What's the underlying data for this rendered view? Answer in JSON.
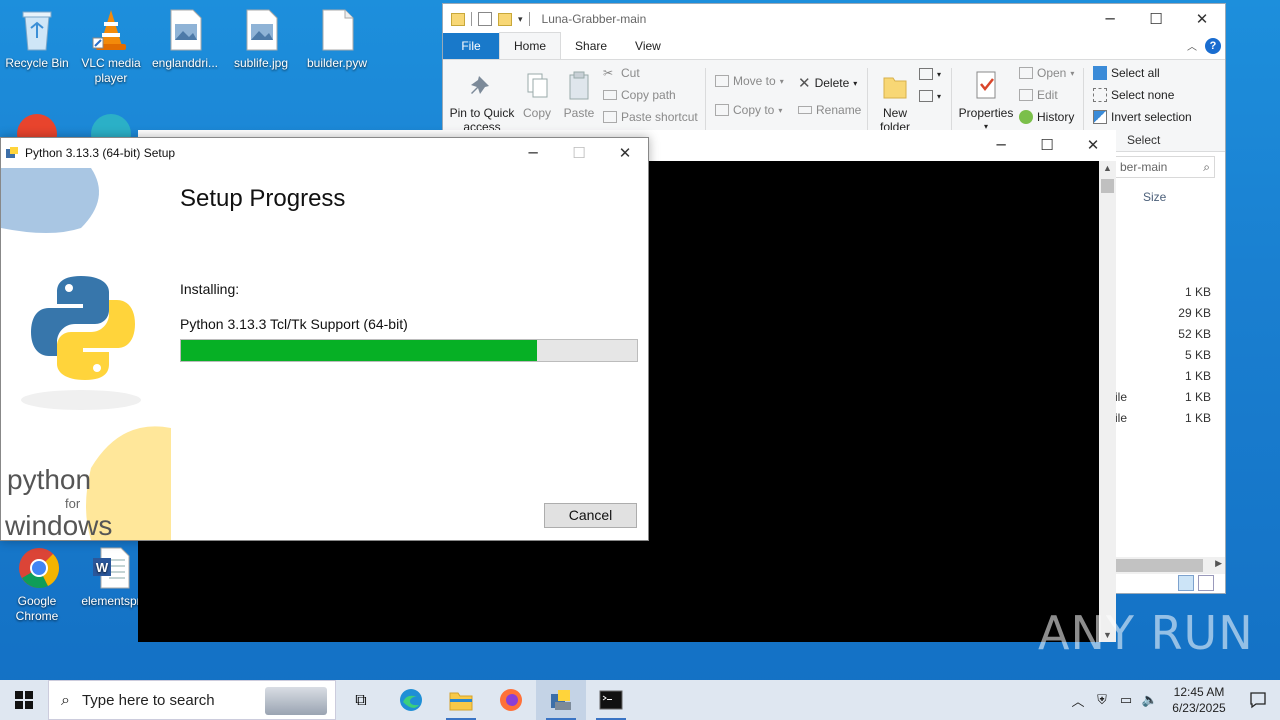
{
  "desktop": {
    "icons": [
      {
        "label": "Recycle Bin"
      },
      {
        "label": "VLC media player"
      },
      {
        "label": "englanddri..."
      },
      {
        "label": "sublife.jpg"
      },
      {
        "label": "builder.pyw"
      },
      {
        "label": "Google Chrome"
      },
      {
        "label": "elementspr"
      }
    ]
  },
  "explorer": {
    "title": "Luna-Grabber-main",
    "tabs": [
      "File",
      "Home",
      "Share",
      "View"
    ],
    "help": "?",
    "ribbon": {
      "pin": "Pin to Quick access",
      "copy": "Copy",
      "paste": "Paste",
      "cut": "Cut",
      "copy_path": "Copy path",
      "paste_shortcut": "Paste shortcut",
      "move_to": "Move to",
      "copy_to": "Copy to",
      "delete": "Delete",
      "rename": "Rename",
      "new_folder": "New folder",
      "properties": "Properties",
      "open": "Open",
      "edit": "Edit",
      "history": "History",
      "select_all": "Select all",
      "select_none": "Select none",
      "invert_selection": "Invert selection",
      "select_group": "Select"
    },
    "search_text": "ber-main",
    "size_header": "Size",
    "rows": [
      {
        "type": "",
        "size": "1 KB"
      },
      {
        "type": "",
        "size": "29 KB"
      },
      {
        "type": "",
        "size": "52 KB"
      },
      {
        "type": "",
        "size": "5 KB"
      },
      {
        "type": "",
        "size": "1 KB"
      },
      {
        "type": "ile",
        "size": "1 KB"
      },
      {
        "type": "ile",
        "size": "1 KB"
      }
    ]
  },
  "setup": {
    "title": "Python 3.13.3 (64-bit) Setup",
    "heading": "Setup Progress",
    "installing_label": "Installing:",
    "component": "Python 3.13.3 Tcl/Tk Support (64-bit)",
    "progress": 0.78,
    "cancel": "Cancel",
    "brand_line1": "python",
    "brand_line2": "for",
    "brand_line3": "windows"
  },
  "taskbar": {
    "search_placeholder": "Type here to search",
    "time": "12:45 AM",
    "date": "6/23/2025"
  },
  "watermark": "ANY RUN",
  "colors": {
    "progress_fill": "#06b025",
    "file_tab": "#1979ca"
  }
}
